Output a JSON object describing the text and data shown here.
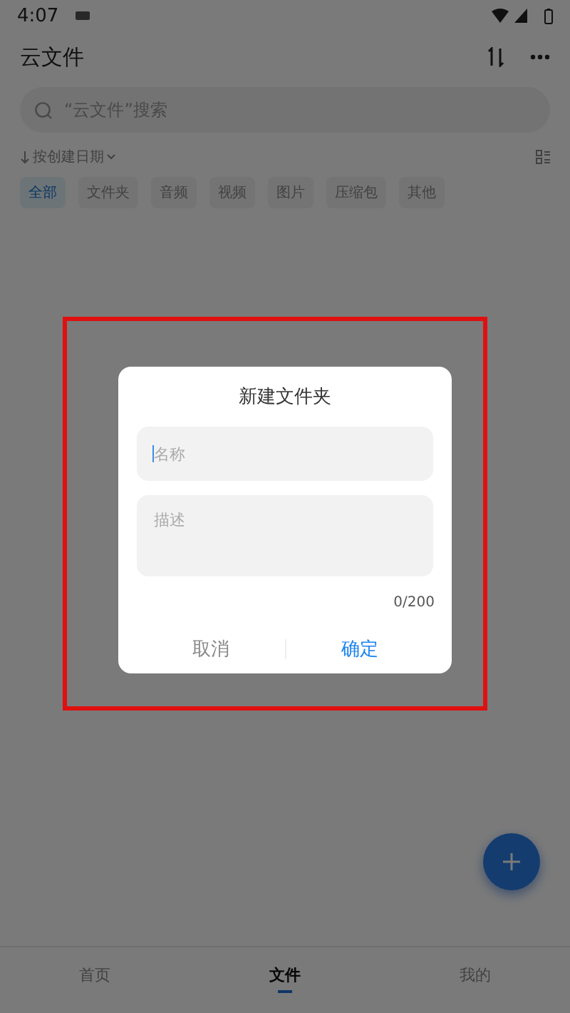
{
  "status_bar": {
    "time": "4:07"
  },
  "header": {
    "title": "云文件"
  },
  "search": {
    "placeholder": "“云文件”搜索"
  },
  "sort": {
    "label": "按创建日期"
  },
  "filters": [
    {
      "label": "全部",
      "selected": true
    },
    {
      "label": "文件夹",
      "selected": false
    },
    {
      "label": "音频",
      "selected": false
    },
    {
      "label": "视频",
      "selected": false
    },
    {
      "label": "图片",
      "selected": false
    },
    {
      "label": "压缩包",
      "selected": false
    },
    {
      "label": "其他",
      "selected": false
    }
  ],
  "dialog": {
    "title": "新建文件夹",
    "name_field": {
      "placeholder": "名称",
      "focused": true
    },
    "description_field": {
      "placeholder": "描述"
    },
    "counter": "0/200",
    "buttons": [
      {
        "label": "取消",
        "kind": "cancel"
      },
      {
        "label": "确定",
        "kind": "confirm"
      }
    ]
  },
  "bottom_nav": [
    {
      "label": "首页",
      "selected": false
    },
    {
      "label": "文件",
      "selected": true
    },
    {
      "label": "我的",
      "selected": false
    }
  ]
}
